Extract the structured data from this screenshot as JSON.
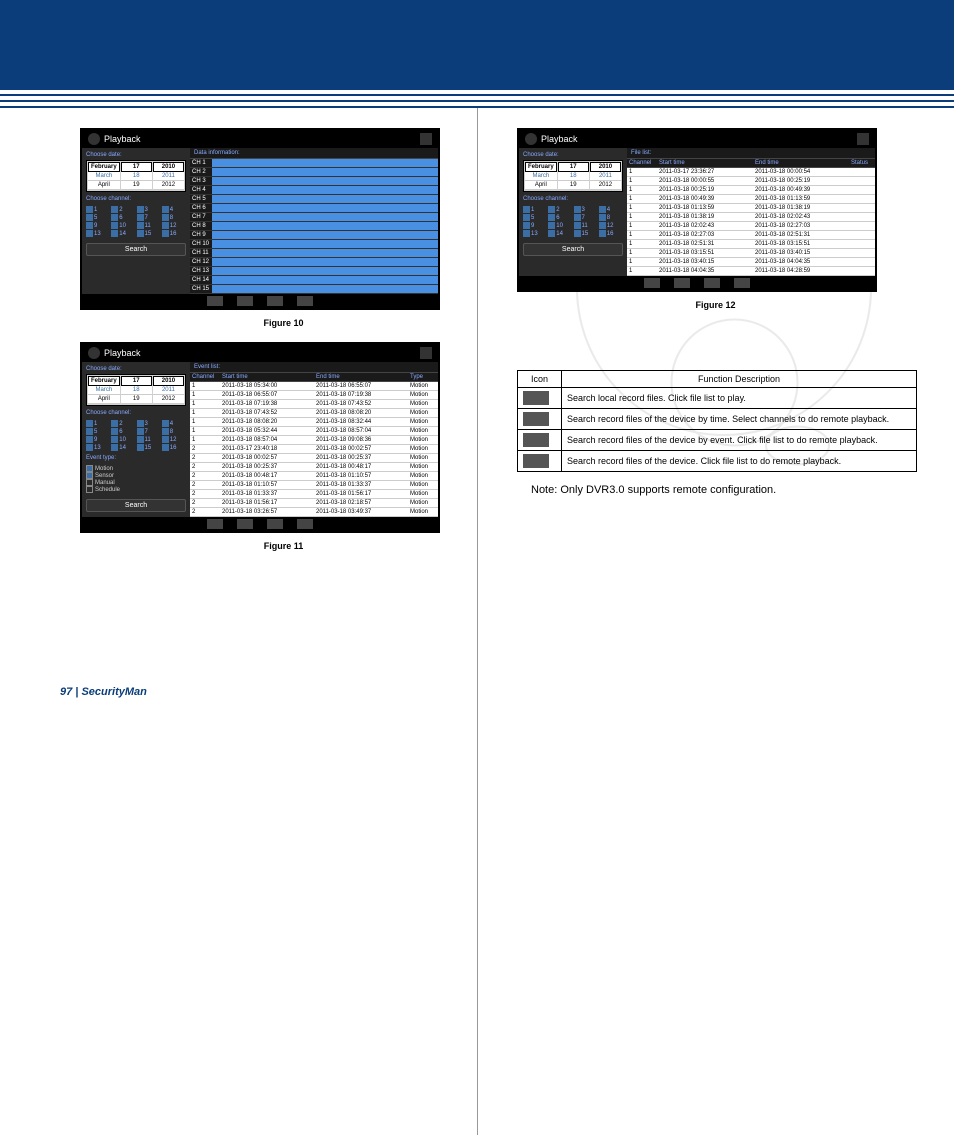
{
  "header": {},
  "figures": {
    "fig10": {
      "title": "Playback",
      "left": {
        "chooseDateLabel": "Choose date:",
        "months": [
          "February",
          "March",
          "April"
        ],
        "days": [
          "17",
          "18",
          "19"
        ],
        "years": [
          "2010",
          "2011",
          "2012"
        ],
        "chooseChannelLabel": "Choose channel:",
        "channels": [
          "1",
          "2",
          "3",
          "4",
          "5",
          "6",
          "7",
          "8",
          "9",
          "10",
          "11",
          "12",
          "13",
          "14",
          "15",
          "16"
        ],
        "searchLabel": "Search"
      },
      "right": {
        "header": "Data information:",
        "rows": [
          "CH 1",
          "CH 2",
          "CH 3",
          "CH 4",
          "CH 5",
          "CH 6",
          "CH 7",
          "CH 8",
          "CH 9",
          "CH 10",
          "CH 11",
          "CH 12",
          "CH 13",
          "CH 14",
          "CH 15"
        ]
      },
      "caption": "Figure 10"
    },
    "fig11": {
      "title": "Playback",
      "left": {
        "chooseDateLabel": "Choose date:",
        "months": [
          "February",
          "March",
          "April"
        ],
        "days": [
          "17",
          "18",
          "19"
        ],
        "years": [
          "2010",
          "2011",
          "2012"
        ],
        "chooseChannelLabel": "Choose channel:",
        "channels": [
          "1",
          "2",
          "3",
          "4",
          "5",
          "6",
          "7",
          "8",
          "9",
          "10",
          "11",
          "12",
          "13",
          "14",
          "15",
          "16"
        ],
        "eventTypeLabel": "Event type:",
        "eventTypes": [
          "Motion",
          "Sensor",
          "Manual",
          "Schedule"
        ],
        "searchLabel": "Search"
      },
      "right": {
        "header": "Event list:",
        "columns": [
          "Channel",
          "Start time",
          "End time",
          "Type"
        ],
        "rows": [
          [
            "1",
            "2011-03-18 05:34:00",
            "2011-03-18 06:55:07",
            "Motion"
          ],
          [
            "1",
            "2011-03-18 06:55:07",
            "2011-03-18 07:19:38",
            "Motion"
          ],
          [
            "1",
            "2011-03-18 07:19:38",
            "2011-03-18 07:43:52",
            "Motion"
          ],
          [
            "1",
            "2011-03-18 07:43:52",
            "2011-03-18 08:08:20",
            "Motion"
          ],
          [
            "1",
            "2011-03-18 08:08:20",
            "2011-03-18 08:32:44",
            "Motion"
          ],
          [
            "1",
            "2011-03-18 05:32:44",
            "2011-03-18 08:57:04",
            "Motion"
          ],
          [
            "1",
            "2011-03-18 08:57:04",
            "2011-03-18 09:08:36",
            "Motion"
          ],
          [
            "2",
            "2011-03-17 23:40:18",
            "2011-03-18 00:02:57",
            "Motion"
          ],
          [
            "2",
            "2011-03-18 00:02:57",
            "2011-03-18 00:25:37",
            "Motion"
          ],
          [
            "2",
            "2011-03-18 00:25:37",
            "2011-03-18 00:48:17",
            "Motion"
          ],
          [
            "2",
            "2011-03-18 00:48:17",
            "2011-03-18 01:10:57",
            "Motion"
          ],
          [
            "2",
            "2011-03-18 01:10:57",
            "2011-03-18 01:33:37",
            "Motion"
          ],
          [
            "2",
            "2011-03-18 01:33:37",
            "2011-03-18 01:56:17",
            "Motion"
          ],
          [
            "2",
            "2011-03-18 01:56:17",
            "2011-03-18 02:18:57",
            "Motion"
          ],
          [
            "2",
            "2011-03-18 03:26:57",
            "2011-03-18 03:49:37",
            "Motion"
          ]
        ]
      },
      "caption": "Figure 11"
    },
    "fig12": {
      "title": "Playback",
      "left": {
        "chooseDateLabel": "Choose date:",
        "months": [
          "February",
          "March",
          "April"
        ],
        "days": [
          "17",
          "18",
          "19"
        ],
        "years": [
          "2010",
          "2011",
          "2012"
        ],
        "chooseChannelLabel": "Choose channel:",
        "channels": [
          "1",
          "2",
          "3",
          "4",
          "5",
          "6",
          "7",
          "8",
          "9",
          "10",
          "11",
          "12",
          "13",
          "14",
          "15",
          "16"
        ],
        "searchLabel": "Search"
      },
      "right": {
        "header": "File list:",
        "columns": [
          "Channel",
          "Start time",
          "End time",
          "Status"
        ],
        "rows": [
          [
            "1",
            "2011-03-17 23:36:27",
            "2011-03-18 00:00:54",
            ""
          ],
          [
            "1",
            "2011-03-18 00:00:55",
            "2011-03-18 00:25:19",
            ""
          ],
          [
            "1",
            "2011-03-18 00:25:19",
            "2011-03-18 00:49:39",
            ""
          ],
          [
            "1",
            "2011-03-18 00:49:39",
            "2011-03-18 01:13:59",
            ""
          ],
          [
            "1",
            "2011-03-18 01:13:59",
            "2011-03-18 01:38:19",
            ""
          ],
          [
            "1",
            "2011-03-18 01:38:19",
            "2011-03-18 02:02:43",
            ""
          ],
          [
            "1",
            "2011-03-18 02:02:43",
            "2011-03-18 02:27:03",
            ""
          ],
          [
            "1",
            "2011-03-18 02:27:03",
            "2011-03-18 02:51:31",
            ""
          ],
          [
            "1",
            "2011-03-18 02:51:31",
            "2011-03-18 03:15:51",
            ""
          ],
          [
            "1",
            "2011-03-18 03:15:51",
            "2011-03-18 03:40:15",
            ""
          ],
          [
            "1",
            "2011-03-18 03:40:15",
            "2011-03-18 04:04:35",
            ""
          ],
          [
            "1",
            "2011-03-18 04:04:35",
            "2011-03-18 04:28:59",
            ""
          ]
        ]
      },
      "caption": "Figure 12"
    }
  },
  "functionTable": {
    "headers": [
      "Icon",
      "Function Description"
    ],
    "rows": [
      "Search local record files. Click file list to play.",
      "Search record files of the device by time. Select channels to do remote playback.",
      "Search record files of the device by event. Click file list to do remote playback.",
      "Search record files of the device. Click file list to do remote playback."
    ]
  },
  "noteLine": "Note: Only DVR3.0 supports remote configuration.",
  "footer": {
    "page": "97",
    "bar": " | ",
    "brand": "SecurityMan"
  }
}
